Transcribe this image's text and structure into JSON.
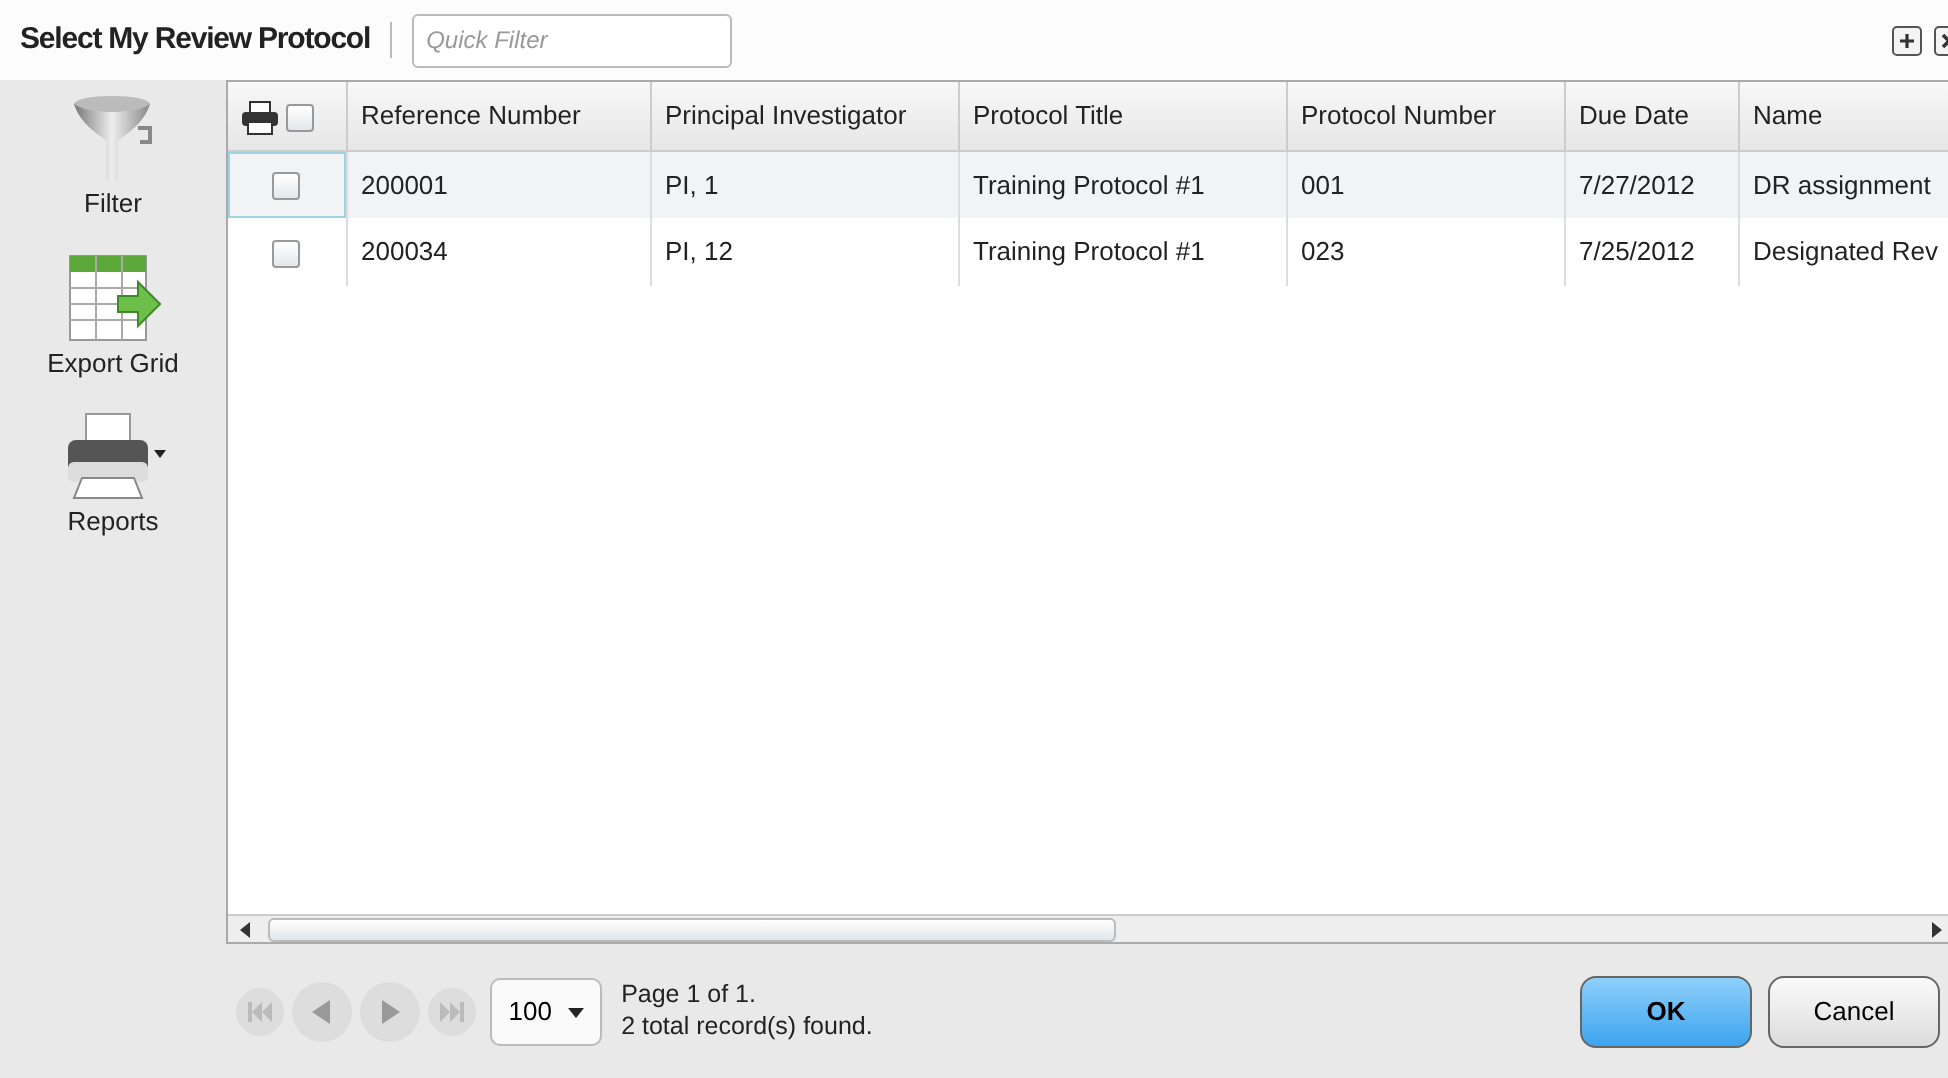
{
  "title": "Select My Review Protocol",
  "quick_filter": {
    "placeholder": "Quick Filter"
  },
  "sidebar": [
    {
      "kind": "filter",
      "label": "Filter"
    },
    {
      "kind": "export",
      "label": "Export Grid"
    },
    {
      "kind": "reports",
      "label": "Reports"
    }
  ],
  "table": {
    "select_all_checked": false,
    "columns": [
      "Reference Number",
      "Principal Investigator",
      "Protocol Title",
      "Protocol Number",
      "Due Date",
      "Name"
    ],
    "rows": [
      {
        "checked": false,
        "cells": [
          "200001",
          "PI, 1",
          "Training Protocol #1",
          "001",
          "7/27/2012",
          "DR assignment"
        ]
      },
      {
        "checked": false,
        "cells": [
          "200034",
          "PI, 12",
          "Training Protocol #1",
          "023",
          "7/25/2012",
          "Designated Rev"
        ]
      }
    ]
  },
  "pager": {
    "page_size": "100",
    "page_info": "Page 1 of 1.",
    "records": "2 total record(s) found."
  },
  "buttons": [
    {
      "label": "OK",
      "kind": "primary"
    },
    {
      "label": "Cancel",
      "kind": "secondary"
    }
  ]
}
